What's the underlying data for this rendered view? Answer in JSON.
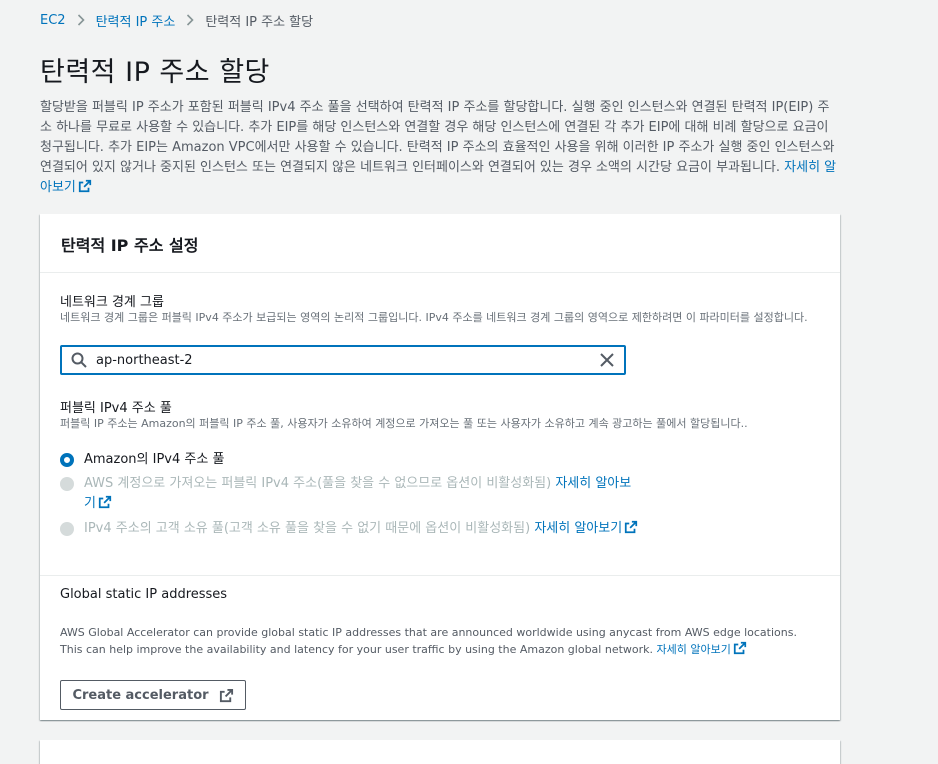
{
  "breadcrumb": {
    "items": [
      {
        "label": "EC2"
      },
      {
        "label": "탄력적 IP 주소"
      },
      {
        "label": "탄력적 IP 주소 할당"
      }
    ]
  },
  "page": {
    "title": "탄력적 IP 주소 할당",
    "description": "할당받을 퍼블릭 IP 주소가 포함된 퍼블릭 IPv4 주소 풀을 선택하여 탄력적 IP 주소를 할당합니다. 실행 중인 인스턴스와 연결된 탄력적 IP(EIP) 주소 하나를 무료로 사용할 수 있습니다. 추가 EIP를 해당 인스턴스와 연결할 경우 해당 인스턴스에 연결된 각 추가 EIP에 대해 비례 할당으로 요금이 청구됩니다. 추가 EIP는 Amazon VPC에서만 사용할 수 있습니다. 탄력적 IP 주소의 효율적인 사용을 위해 이러한 IP 주소가 실행 중인 인스턴스와 연결되어 있지 않거나 중지된 인스턴스 또는 연결되지 않은 네트워크 인터페이스와 연결되어 있는 경우 소액의 시간당 요금이 부과됩니다. ",
    "learn_more": "자세히 알아보기"
  },
  "settings": {
    "header": "탄력적 IP 주소 설정",
    "network_border_group": {
      "label": "네트워크 경계 그룹",
      "description": "네트워크 경계 그룹은 퍼블릭 IPv4 주소가 보급되는 영역의 논리적 그룹입니다. IPv4 주소를 네트워크 경계 그룹의 영역으로 제한하려면 이 파라미터를 설정합니다.",
      "value": "ap-northeast-2"
    },
    "ipv4_pool": {
      "label": "퍼블릭 IPv4 주소 풀",
      "description": "퍼블릭 IP 주소는 Amazon의 퍼블릭 IP 주소 풀, 사용자가 소유하여 계정으로 가져오는 풀 또는 사용자가 소유하고 계속 광고하는 풀에서 할당됩니다..",
      "options": [
        {
          "label": "Amazon의 IPv4 주소 풀",
          "link": "",
          "selected": true,
          "disabled": false
        },
        {
          "label": "AWS 계정으로 가져오는 퍼블릭 IPv4 주소(풀을 찾을 수 없으므로 옵션이 비활성화됨) ",
          "link": "자세히 알아보기",
          "selected": false,
          "disabled": true
        },
        {
          "label": "IPv4 주소의 고객 소유 풀(고객 소유 풀을 찾을 수 없기 때문에 옵션이 비활성화됨) ",
          "link": "자세히 알아보기",
          "selected": false,
          "disabled": true
        }
      ]
    },
    "global": {
      "title": "Global static IP addresses",
      "description": "AWS Global Accelerator can provide global static IP addresses that are announced worldwide using anycast from AWS edge locations. This can help improve the availability and latency for your user traffic by using the Amazon global network. ",
      "learn_more": "자세히 알아보기",
      "button": "Create accelerator"
    }
  },
  "colors": {
    "link": "#0073bb",
    "background": "#f2f3f3",
    "disabled_text": "#aab7b8"
  }
}
